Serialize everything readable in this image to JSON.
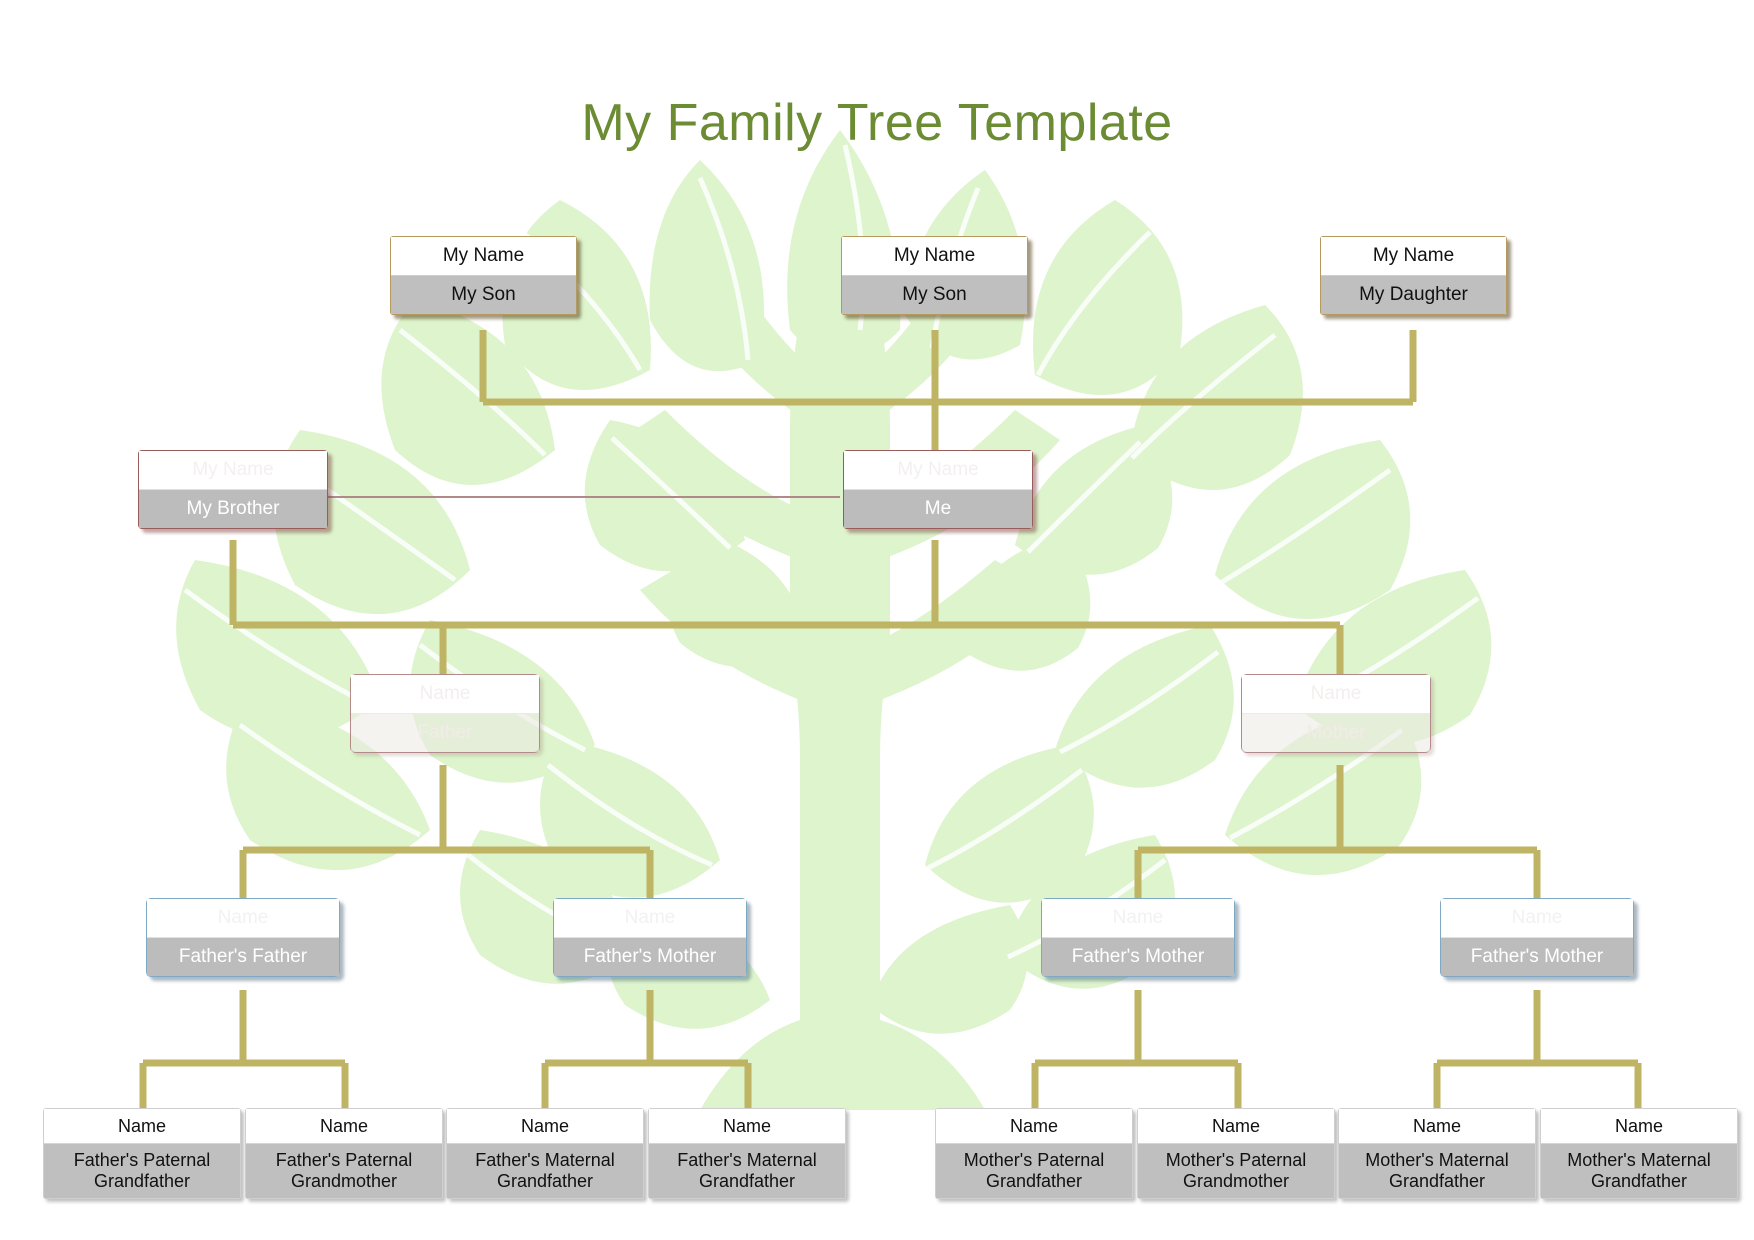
{
  "page": {
    "title": "My Family Tree Template",
    "title_color": "#6b8c33",
    "background_color": "#ffffff",
    "connector_color": "#bfb464",
    "label_band_color": "#bfbfbf"
  },
  "generations": {
    "children": {
      "name_label": "My Name",
      "nodes": [
        {
          "name": "My Name",
          "relation": "My Son"
        },
        {
          "name": "My Name",
          "relation": "My Son"
        },
        {
          "name": "My Name",
          "relation": "My Daughter"
        }
      ]
    },
    "self": {
      "nodes": [
        {
          "name": "My Name",
          "relation": "My Brother"
        },
        {
          "name": "My Name",
          "relation": "Me"
        }
      ]
    },
    "parents": {
      "nodes": [
        {
          "name": "Name",
          "relation": "Father"
        },
        {
          "name": "Name",
          "relation": "Mother"
        }
      ]
    },
    "grandparents": {
      "nodes": [
        {
          "name": "Name",
          "relation": "Father's Father"
        },
        {
          "name": "Name",
          "relation": "Father's Mother"
        },
        {
          "name": "Name",
          "relation": "Father's Mother"
        },
        {
          "name": "Name",
          "relation": "Father's Mother"
        }
      ]
    },
    "great_grandparents": {
      "nodes": [
        {
          "name": "Name",
          "relation": "Father's Paternal Grandfather"
        },
        {
          "name": "Name",
          "relation": "Father's Paternal Grandmother"
        },
        {
          "name": "Name",
          "relation": "Father's Maternal Grandfather"
        },
        {
          "name": "Name",
          "relation": "Father's Maternal Grandfather"
        },
        {
          "name": "Name",
          "relation": "Mother's Paternal Grandfather"
        },
        {
          "name": "Name",
          "relation": "Mother's Paternal Grandmother"
        },
        {
          "name": "Name",
          "relation": "Mother's Maternal Grandfather"
        },
        {
          "name": "Name",
          "relation": "Mother's Maternal Grandfather"
        }
      ]
    }
  }
}
